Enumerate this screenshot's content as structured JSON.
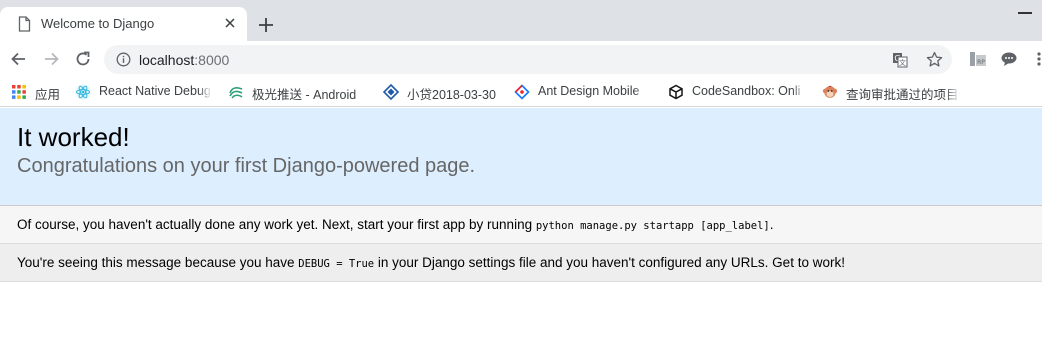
{
  "browser": {
    "tab": {
      "title": "Welcome to Django",
      "icon": "page-icon"
    },
    "url": {
      "host": "localhost",
      "port": ":8000"
    },
    "bookmarks": [
      {
        "label": "应用",
        "icon": "apps-grid-icon"
      },
      {
        "label": "React Native Debug",
        "icon": "react-icon"
      },
      {
        "label": "极光推送 - Android",
        "icon": "jpush-icon"
      },
      {
        "label": "小贷2018-03-30",
        "icon": "diamond-icon"
      },
      {
        "label": "Ant Design Mobile",
        "icon": "ant-design-icon"
      },
      {
        "label": "CodeSandbox: Onli",
        "icon": "codesandbox-icon"
      },
      {
        "label": "查询审批通过的项目信",
        "icon": "monkey-icon"
      }
    ],
    "colors": {
      "tabstrip": "#dee1e6",
      "omnibox": "#f1f3f4",
      "accent": "#1a73e8"
    }
  },
  "page": {
    "heading": "It worked!",
    "subheading": "Congratulations on your first Django-powered page.",
    "instructions": {
      "before": "Of course, you haven't actually done any work yet. Next, start your first app by running ",
      "code": "python manage.py startapp [app_label]",
      "after": "."
    },
    "explanation": {
      "before": "You're seeing this message because you have ",
      "code": "DEBUG = True",
      "after": " in your Django settings file and you haven't configured any URLs. Get to work!"
    },
    "colors": {
      "hero": "#ddeeff",
      "row1": "#f6f6f6",
      "row2": "#eeeeee",
      "subheading": "#666666"
    }
  }
}
